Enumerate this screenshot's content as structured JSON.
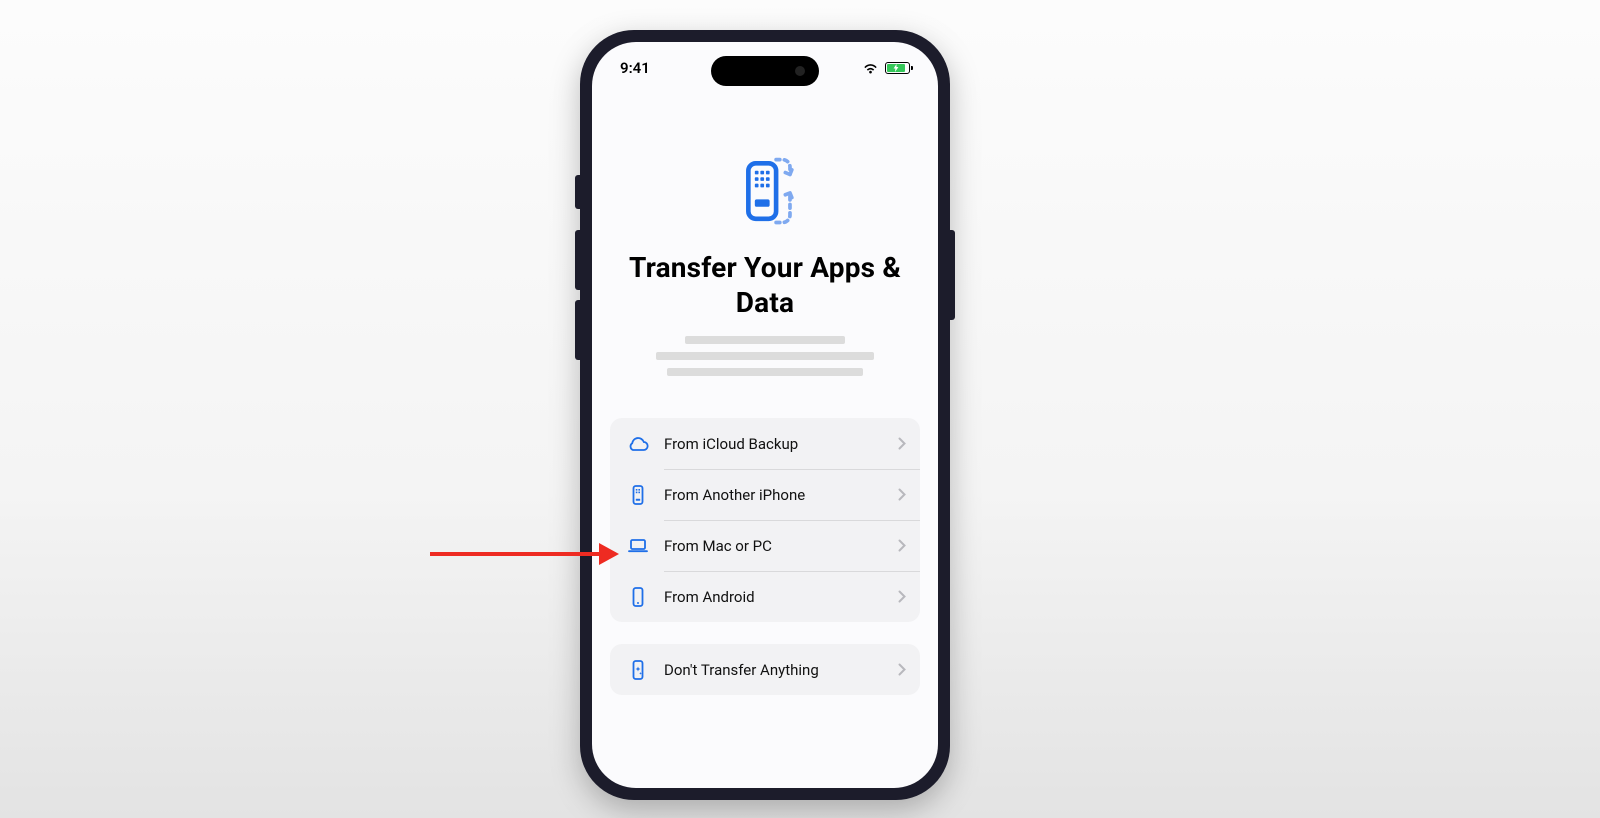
{
  "status": {
    "time": "9:41"
  },
  "title": "Transfer Your Apps & Data",
  "options": [
    {
      "label": "From iCloud Backup"
    },
    {
      "label": "From Another iPhone"
    },
    {
      "label": "From Mac or PC"
    },
    {
      "label": "From Android"
    }
  ],
  "skip": {
    "label": "Don't Transfer Anything"
  }
}
